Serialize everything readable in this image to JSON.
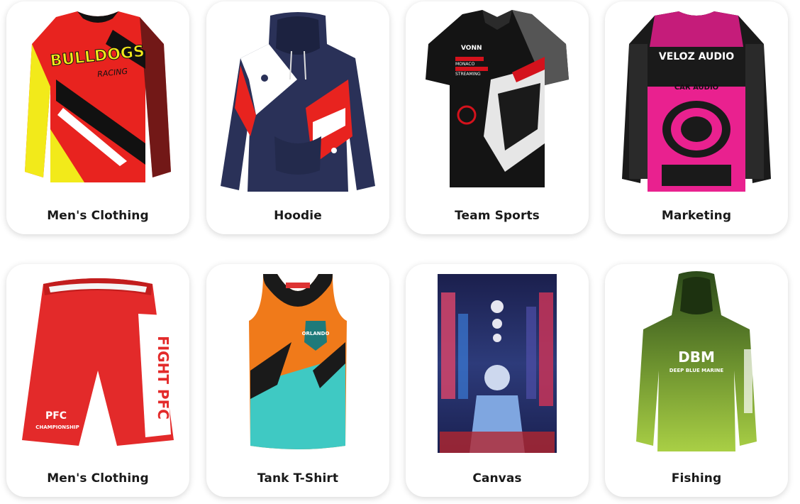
{
  "categories": [
    {
      "label": "Men's Clothing",
      "image": "long-sleeve jersey, red/yellow, BULLDOGS RACING"
    },
    {
      "label": "Hoodie",
      "image": "navy hoodie with red and white paw print design"
    },
    {
      "label": "Team Sports",
      "image": "black racing polo shirt with race car graphic"
    },
    {
      "label": "Marketing",
      "image": "pink/black long-sleeve jersey, VELOZ AUDIO"
    },
    {
      "label": "Men's Clothing",
      "image": "red shorts, FIGHT PFC"
    },
    {
      "label": "Tank T-Shirt",
      "image": "orange/teal tank top, ORLANDO"
    },
    {
      "label": "Canvas",
      "image": "astronaut in neon city canvas print"
    },
    {
      "label": "Fishing",
      "image": "green hooded fishing shirt, DEEP BLUE MARINE"
    }
  ],
  "art_text": {
    "bulldogs_line1": "BULLDOGS",
    "bulldogs_line2": "RACING",
    "veloz": "VELOZ AUDIO",
    "car_audio": "CAR AUDIO",
    "fight": "FIGHT PFC",
    "pfc": "PFC",
    "championship": "CHAMPIONSHIP",
    "orlando": "ORLANDO",
    "dbm": "DBM",
    "deep_blue": "DEEP BLUE MARINE",
    "von": "VONN",
    "streaming": "STREAMING",
    "monaco": "MONACO"
  },
  "colors": {
    "card_bg": "#ffffff",
    "label": "#1a1a1a",
    "jersey_red": "#e8231f",
    "jersey_yellow": "#f2ea1a",
    "hoodie_navy": "#2a3158",
    "pink": "#e9218f",
    "shorts_red": "#e32a2a",
    "tank_orange": "#f07a1a",
    "tank_teal": "#3fc9c3",
    "fish_dark": "#2c4a1a",
    "fish_light": "#a9cf45"
  }
}
